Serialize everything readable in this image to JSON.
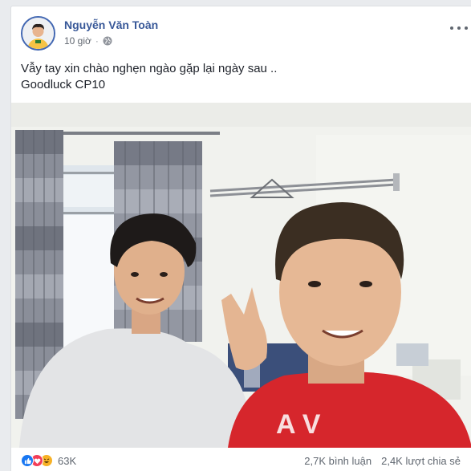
{
  "post": {
    "author": "Nguyễn Văn Toàn",
    "time": "10 giờ",
    "privacy_icon": "globe-icon",
    "more_icon": "more-options-icon",
    "text_line1": "Vẫy tay xin chào nghẹn ngào gặp lại ngày sau ..",
    "text_line2": "Goodluck CP10"
  },
  "footer": {
    "reaction_icons": [
      "like-icon",
      "love-icon",
      "haha-icon"
    ],
    "reaction_count": "63K",
    "comments": "2,7K bình luận",
    "shares": "2,4K lượt chia sẻ"
  },
  "colors": {
    "author": "#385898",
    "like": "#1877f2",
    "love": "#f33e58",
    "haha": "#f7b125"
  }
}
